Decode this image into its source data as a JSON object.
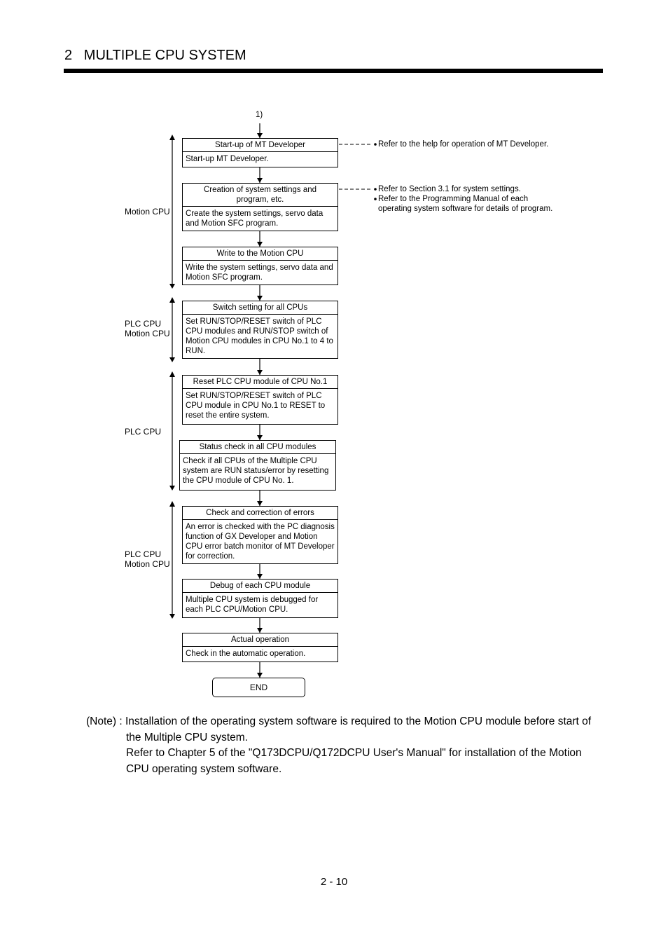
{
  "header": {
    "title": "2   MULTIPLE CPU SYSTEM"
  },
  "flow": {
    "start_connector": "1)",
    "steps": [
      {
        "title": "Start-up of MT Developer",
        "body": "Start-up MT Developer."
      },
      {
        "title": "Creation of system settings and program, etc.",
        "body": "Create the system settings, servo data and Motion SFC program."
      },
      {
        "title": "Write to the Motion CPU",
        "body": "Write the system settings, servo data and Motion SFC program."
      },
      {
        "title": "Switch setting for all CPUs",
        "body": "Set RUN/STOP/RESET switch of PLC CPU modules and RUN/STOP switch of Motion CPU modules in CPU No.1 to 4 to RUN."
      },
      {
        "title": "Reset PLC CPU module of CPU No.1",
        "body": "Set RUN/STOP/RESET switch of PLC CPU module in CPU No.1 to RESET to reset the entire system."
      },
      {
        "title": "Status check in all CPU modules",
        "body": "Check if all CPUs of the Multiple CPU system are RUN status/error by resetting the CPU module of CPU No. 1."
      },
      {
        "title": "Check and correction of errors",
        "body": "An error is checked with the PC diagnosis function of GX Developer and Motion CPU error batch monitor of MT Developer for correction."
      },
      {
        "title": "Debug of each CPU module",
        "body": "Multiple CPU system is debugged for each PLC CPU/Motion CPU."
      },
      {
        "title": "Actual operation",
        "body": "Check in the automatic operation."
      }
    ],
    "end_label": "END",
    "phases": [
      {
        "label_line1": "Motion CPU",
        "label_line2": ""
      },
      {
        "label_line1": "PLC CPU",
        "label_line2": "Motion CPU"
      },
      {
        "label_line1": "PLC CPU",
        "label_line2": ""
      },
      {
        "label_line1": "PLC CPU",
        "label_line2": "Motion CPU"
      }
    ],
    "references": [
      {
        "items": [
          "Refer to the help for operation of MT Developer."
        ]
      },
      {
        "items": [
          "Refer to Section 3.1 for system settings.",
          "Refer to the Programming Manual of each",
          "operating system software for details of program."
        ]
      }
    ]
  },
  "note": {
    "prefix": "(Note) : ",
    "line1": "Installation of the operating system software is required to the Motion CPU module before start of",
    "line2": "the Multiple CPU system.",
    "line3": "Refer to Chapter 5 of the \"Q173DCPU/Q172DCPU User's Manual\" for installation of the Motion",
    "line4": "CPU operating system software."
  },
  "footer": {
    "page_number": "2 - 10"
  }
}
